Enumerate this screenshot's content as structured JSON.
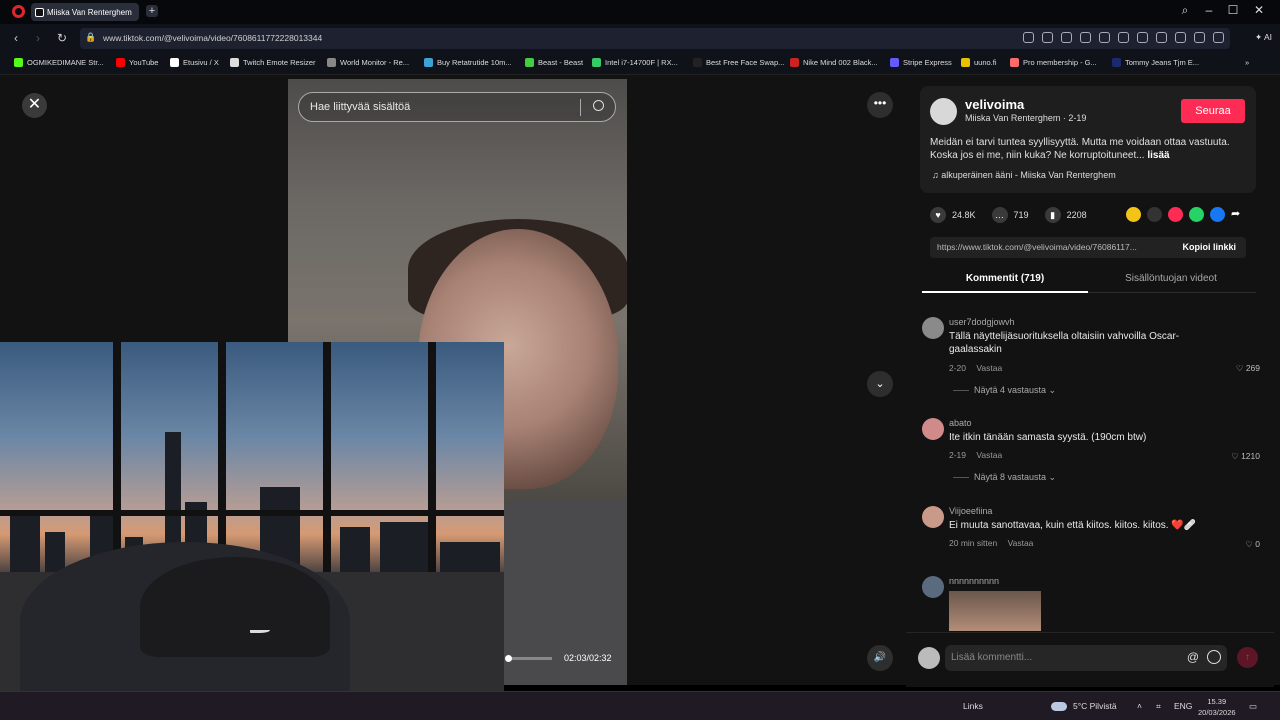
{
  "browser": {
    "tab_title": "Miiska Van Renterghem",
    "url": "www.tiktok.com/@velivoima/video/7608611772228013344",
    "ai_label": "AI",
    "bookmarks": [
      {
        "label": "OGMIKEDIMANE Str...",
        "color": "#53fc18"
      },
      {
        "label": "YouTube",
        "color": "#ff0000"
      },
      {
        "label": "Etusivu / X",
        "color": "#ffffff"
      },
      {
        "label": "Twitch Emote Resizer",
        "color": "#dddddd"
      },
      {
        "label": "World Monitor - Re...",
        "color": "#888888"
      },
      {
        "label": "Buy Retatrutide 10m...",
        "color": "#3ba3d6"
      },
      {
        "label": "Beast - Beast",
        "color": "#44cc44"
      },
      {
        "label": "Intel i7-14700F | RX...",
        "color": "#33cc66"
      },
      {
        "label": "Best Free Face Swap...",
        "color": "#222222"
      },
      {
        "label": "Nike Mind 002 Black...",
        "color": "#cc2222"
      },
      {
        "label": "Stripe Express",
        "color": "#635bff"
      },
      {
        "label": "uuno.fi",
        "color": "#e6c200"
      },
      {
        "label": "Pro membership - G...",
        "color": "#ff6b6b"
      },
      {
        "label": "Tommy Jeans Tjm E...",
        "color": "#1a2a6c"
      }
    ]
  },
  "video": {
    "search_placeholder": "Hae liittyvää sisältöä",
    "timecode": "02:03/02:32",
    "progress_fraction": 0.05
  },
  "post": {
    "username": "velivoima",
    "display_name": "Miiska Van Renterghem",
    "date": "2-19",
    "follow_label": "Seuraa",
    "description": "Meidän ei tarvi tuntea syyllisyyttä. Mutta me voidaan ottaa vastuuta. Koska jos ei me, niin kuka? Ne korruptoituneet...",
    "more_label": "lisää",
    "music": "alkuperäinen ääni - Miiska Van Renterghem",
    "likes": "24.8K",
    "comments": "719",
    "saves": "2208",
    "link": "https://www.tiktok.com/@velivoima/video/76086117...",
    "copy_label": "Kopioi linkki"
  },
  "tabs": {
    "comments": "Kommentit (719)",
    "creator_videos": "Sisällöntuojan videot"
  },
  "comments": [
    {
      "user": "user7dodgjowvh",
      "text": "Tällä näyttelijäsuorituksella oltaisiin vahvoilla Oscar-gaalassakin",
      "time": "2-20",
      "reply": "Vastaa",
      "likes": "269",
      "more": "Näytä 4 vastausta"
    },
    {
      "user": "abato",
      "text": "Ite itkin tänään samasta syystä. (190cm btw)",
      "time": "2-19",
      "reply": "Vastaa",
      "likes": "1210",
      "more": "Näytä 8 vastausta"
    },
    {
      "user": "Viijoeefiina",
      "text": "Ei muuta sanottavaa, kuin että kiitos. kiitos. kiitos. ❤️🩹",
      "time": "20 min sitten",
      "reply": "Vastaa",
      "likes": "0",
      "more": ""
    },
    {
      "user": "nnnnnnnnnn",
      "text": "",
      "time": "",
      "reply": "",
      "likes": "",
      "more": ""
    }
  ],
  "comment_input": {
    "placeholder": "Lisää kommentti..."
  },
  "taskbar": {
    "links": "Links",
    "weather": "5°C  Pilvistä",
    "lang": "ENG",
    "time": "15.39",
    "date": "20/03/2026"
  }
}
